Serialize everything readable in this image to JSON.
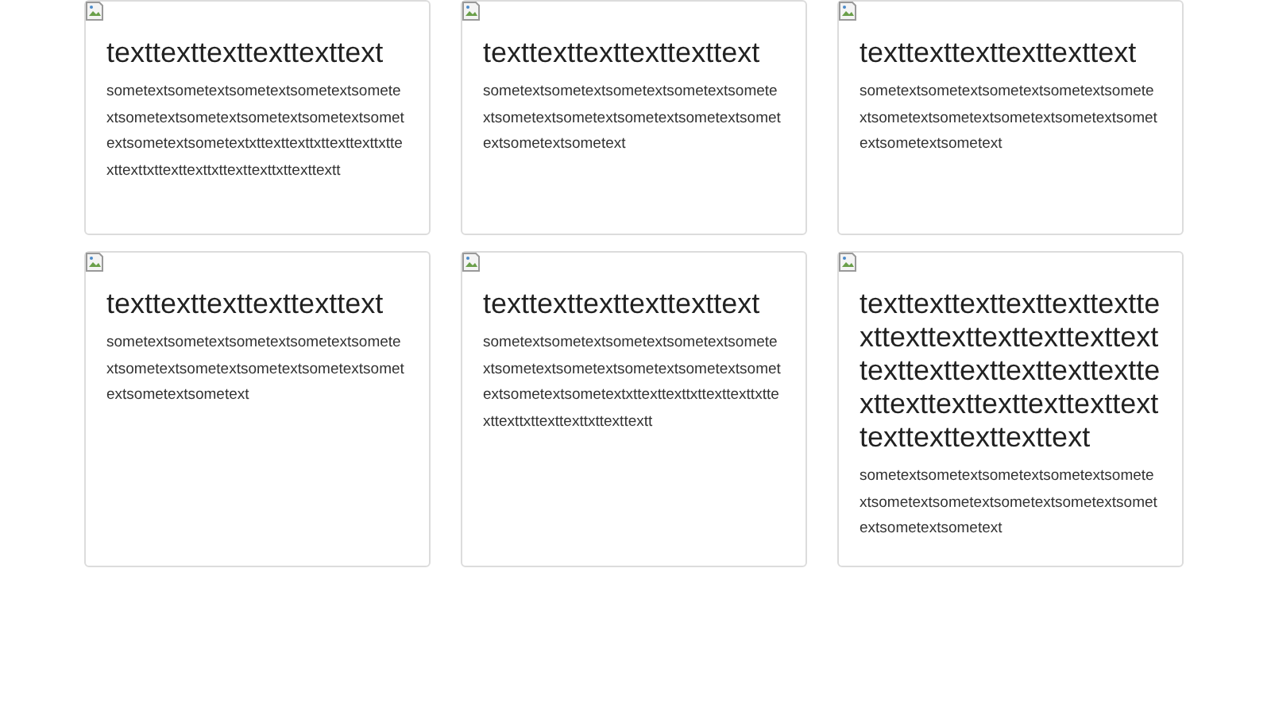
{
  "cards": [
    {
      "title": "texttexttexttexttexttext",
      "body": "sometextsometextsometextsometextsometextsometextsometextsometextsometextsometextsometextsometextxttexttexttxttexttexttxttexttexttxttexttexttxttexttexttxttexttextt"
    },
    {
      "title": "texttexttexttexttexttext",
      "body": "sometextsometextsometextsometextsometextsometextsometextsometextsometextsometextsometextsometext"
    },
    {
      "title": "texttexttexttexttexttext",
      "body": "sometextsometextsometextsometextsometextsometextsometextsometextsometextsometextsometextsometext"
    },
    {
      "title": "texttexttexttexttexttext",
      "body": "sometextsometextsometextsometextsometextsometextsometextsometextsometextsometextsometextsometext"
    },
    {
      "title": "texttexttexttexttexttext",
      "body": "sometextsometextsometextsometextsometextsometextsometextsometextsometextsometextsometextsometextxttexttexttxttexttexttxttexttexttxttexttexttxttexttextt"
    },
    {
      "title": "texttexttexttexttexttexttexttexttexttexttexttexttexttexttexttexttexttexttexttexttexttexttexttexttexttexttexttexttexttexttext",
      "body": "sometextsometextsometextsometextsometextsometextsometextsometextsometextsometextsometextsometext"
    }
  ]
}
